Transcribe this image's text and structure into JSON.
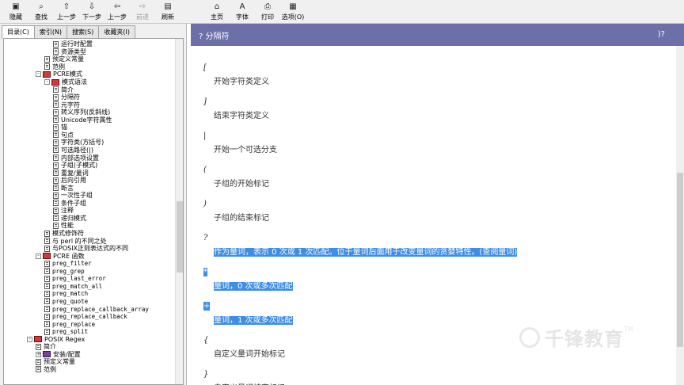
{
  "toolbar": {
    "buttons": [
      {
        "label": "隐藏",
        "icon": "▣"
      },
      {
        "label": "查找",
        "icon": "⌕"
      },
      {
        "label": "上一步",
        "icon": "⇧"
      },
      {
        "label": "下一步",
        "icon": "⇩"
      },
      {
        "label": "上一步",
        "icon": "⇦"
      },
      {
        "label": "前进",
        "icon": "⇨"
      },
      {
        "label": "刷新",
        "icon": "▤"
      },
      {
        "label": "主页",
        "icon": "⌂"
      },
      {
        "label": "字体",
        "icon": "A"
      },
      {
        "label": "打印",
        "icon": "⎙"
      },
      {
        "label": "选项(O)",
        "icon": "▦"
      }
    ]
  },
  "tabs": [
    "目录(C)",
    "索引(N)",
    "搜索(S)",
    "收藏夹(I)"
  ],
  "tree": [
    {
      "text": "运行时配置",
      "level": 6,
      "type": "page",
      "mono": false
    },
    {
      "text": "资源类型",
      "level": 6,
      "type": "page",
      "mono": false
    },
    {
      "text": "预定义常量",
      "level": 5,
      "type": "page",
      "mono": false
    },
    {
      "text": "范例",
      "level": 5,
      "type": "page",
      "mono": false
    },
    {
      "text": "PCRE模式",
      "level": 4,
      "type": "book",
      "mono": false,
      "expander": "-"
    },
    {
      "text": "模式语法",
      "level": 5,
      "type": "book",
      "mono": false,
      "expander": "-"
    },
    {
      "text": "简介",
      "level": 6,
      "type": "page",
      "mono": false
    },
    {
      "text": "分隔符",
      "level": 6,
      "type": "page",
      "mono": false
    },
    {
      "text": "元字符",
      "level": 6,
      "type": "page",
      "mono": false
    },
    {
      "text": "转义序列(反斜线)",
      "level": 6,
      "type": "page",
      "mono": false
    },
    {
      "text": "Unicode字符属性",
      "level": 6,
      "type": "page",
      "mono": false
    },
    {
      "text": "锚",
      "level": 6,
      "type": "page",
      "mono": false
    },
    {
      "text": "句点",
      "level": 6,
      "type": "page",
      "mono": false
    },
    {
      "text": "字符类(方括号)",
      "level": 6,
      "type": "page",
      "mono": false
    },
    {
      "text": "可选路径(|)",
      "level": 6,
      "type": "page",
      "mono": false
    },
    {
      "text": "内部选项设置",
      "level": 6,
      "type": "page",
      "mono": false
    },
    {
      "text": "子组(子模式)",
      "level": 6,
      "type": "page",
      "mono": false
    },
    {
      "text": "重复/量词",
      "level": 6,
      "type": "page",
      "mono": false
    },
    {
      "text": "后向引用",
      "level": 6,
      "type": "page",
      "mono": false
    },
    {
      "text": "断言",
      "level": 6,
      "type": "page",
      "mono": false
    },
    {
      "text": "一次性子组",
      "level": 6,
      "type": "page",
      "mono": false
    },
    {
      "text": "条件子组",
      "level": 6,
      "type": "page",
      "mono": false
    },
    {
      "text": "注释",
      "level": 6,
      "type": "page",
      "mono": false
    },
    {
      "text": "递归模式",
      "level": 6,
      "type": "page",
      "mono": false
    },
    {
      "text": "性能",
      "level": 6,
      "type": "page",
      "mono": false
    },
    {
      "text": "模式修饰符",
      "level": 5,
      "type": "page",
      "mono": false
    },
    {
      "text": "与 perl 的不同之处",
      "level": 5,
      "type": "page",
      "mono": false
    },
    {
      "text": "与POSIX正则表达式的不同",
      "level": 5,
      "type": "page",
      "mono": false
    },
    {
      "text": "PCRE 函数",
      "level": 4,
      "type": "book",
      "mono": false,
      "expander": "-"
    },
    {
      "text": "preg_filter",
      "level": 5,
      "type": "page",
      "mono": true
    },
    {
      "text": "preg_grep",
      "level": 5,
      "type": "page",
      "mono": true
    },
    {
      "text": "preg_last_error",
      "level": 5,
      "type": "page",
      "mono": true
    },
    {
      "text": "preg_match_all",
      "level": 5,
      "type": "page",
      "mono": true
    },
    {
      "text": "preg_match",
      "level": 5,
      "type": "page",
      "mono": true
    },
    {
      "text": "preg_quote",
      "level": 5,
      "type": "page",
      "mono": true
    },
    {
      "text": "preg_replace_callback_array",
      "level": 5,
      "type": "page",
      "mono": true
    },
    {
      "text": "preg_replace_callback",
      "level": 5,
      "type": "page",
      "mono": true
    },
    {
      "text": "preg_replace",
      "level": 5,
      "type": "page",
      "mono": true
    },
    {
      "text": "preg_split",
      "level": 5,
      "type": "page",
      "mono": true
    },
    {
      "text": "POSIX Regex",
      "level": 3,
      "type": "book",
      "mono": false,
      "expander": "-"
    },
    {
      "text": "简介",
      "level": 4,
      "type": "page",
      "mono": false
    },
    {
      "text": "安装/配置",
      "level": 4,
      "type": "book-purple",
      "mono": false,
      "expander": "+"
    },
    {
      "text": "预定义常量",
      "level": 4,
      "type": "page",
      "mono": false
    },
    {
      "text": "范例",
      "level": 4,
      "type": "page",
      "mono": false
    }
  ],
  "topic": {
    "title": "? 分隔符",
    "help_mark": ")?"
  },
  "entries": [
    {
      "term": "[",
      "desc": "开始字符类定义",
      "highlight": false
    },
    {
      "term": "]",
      "desc": "结束字符类定义",
      "highlight": false
    },
    {
      "term": "|",
      "desc": "开始一个可选分支",
      "highlight": false
    },
    {
      "term": "(",
      "desc": "子组的开始标记",
      "highlight": false
    },
    {
      "term": ")",
      "desc": "子组的结束标记",
      "highlight": false
    },
    {
      "term": "?",
      "desc": "作为量词，表示 0 次或 1 次匹配。位于量词后面用于改变量词的贪婪特性。(查阅量词)",
      "highlight": true
    },
    {
      "term": "*",
      "desc": "量词，0 次或多次匹配",
      "highlight": true
    },
    {
      "term": "+",
      "desc": "量词，1 次或多次匹配",
      "highlight": true
    },
    {
      "term": "{",
      "desc": "自定义量词开始标记",
      "highlight": false
    },
    {
      "term": "}",
      "desc": "自定义量词结束标记",
      "highlight": false
    }
  ],
  "watermark": {
    "text": "千锋教育",
    "tm": "TM"
  },
  "colors": {
    "header_bg": "#6d6fa8",
    "highlight": "#3e8de6"
  }
}
